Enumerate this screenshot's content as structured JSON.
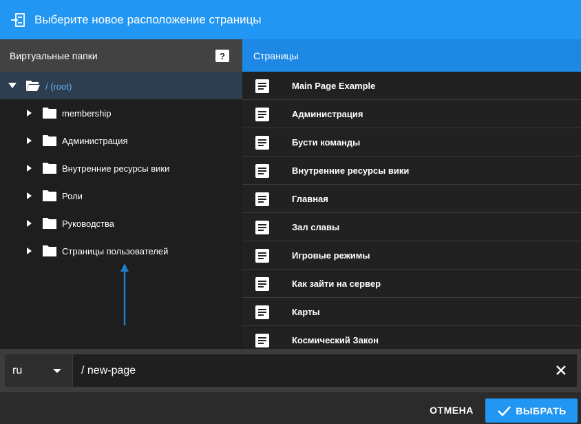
{
  "dialog": {
    "title": "Выберите новое расположение страницы"
  },
  "folders_panel": {
    "title": "Виртуальные папки",
    "help_label": "?",
    "root_label": "/ (root)",
    "items": [
      {
        "label": "membership"
      },
      {
        "label": "Администрация"
      },
      {
        "label": "Внутренние ресурсы вики"
      },
      {
        "label": "Роли"
      },
      {
        "label": "Руководства"
      },
      {
        "label": "Страницы пользователей"
      }
    ]
  },
  "pages_panel": {
    "title": "Страницы",
    "items": [
      {
        "label": "Main Page Example"
      },
      {
        "label": "Администрация"
      },
      {
        "label": "Бусти команды"
      },
      {
        "label": "Внутренние ресурсы вики"
      },
      {
        "label": "Главная"
      },
      {
        "label": "Зал славы"
      },
      {
        "label": "Игровые режимы"
      },
      {
        "label": "Как зайти на сервер"
      },
      {
        "label": "Карты"
      },
      {
        "label": "Космический Закон"
      }
    ]
  },
  "path_bar": {
    "locale": "ru",
    "path": "/ new-page"
  },
  "footer": {
    "cancel_label": "ОТМЕНА",
    "select_label": "ВЫБРАТЬ"
  },
  "colors": {
    "accent": "#2196f3",
    "root_highlight": "#2d3e50",
    "root_text": "#64b5f6",
    "annotation_arrow": "#1e7fc4"
  }
}
